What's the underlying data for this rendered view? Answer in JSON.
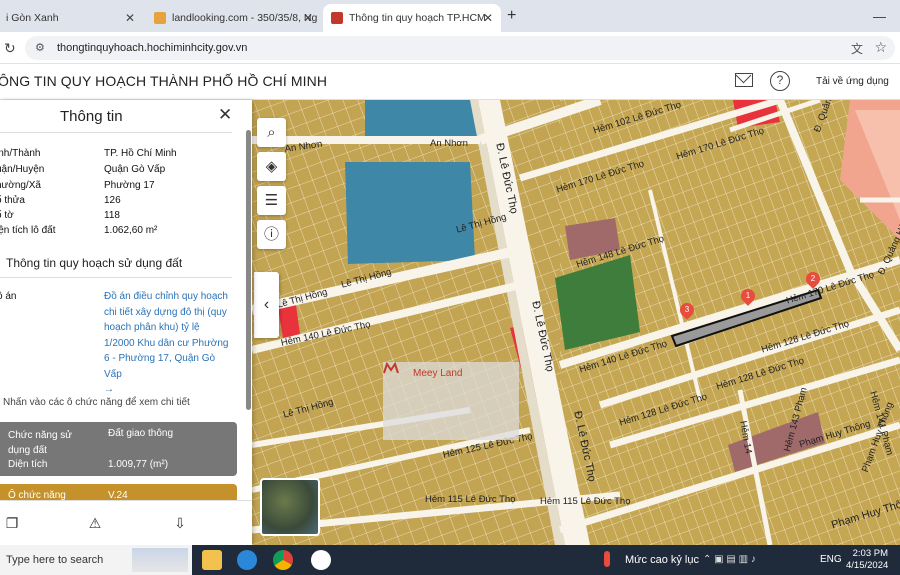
{
  "browser": {
    "tabs": [
      {
        "label": "i Gòn Xanh",
        "active": false
      },
      {
        "label": "landlooking.com - 350/35/8, Ng",
        "active": false
      },
      {
        "label": "Thông tin quy hoạch TP.HCM",
        "active": true
      }
    ],
    "url": "thongtinquyhoach.hochiminhcity.gov.vn"
  },
  "site": {
    "title": "ÔNG TIN QUY HOẠCH THÀNH PHỐ HỒ CHÍ MINH",
    "download_app": "Tải về ứng dụng"
  },
  "panel": {
    "title": "Thông tin",
    "fields": [
      {
        "key": "ỉnh/Thành",
        "value": "TP. Hồ Chí Minh"
      },
      {
        "key": "uận/Huyện",
        "value": "Quận Gò Vấp"
      },
      {
        "key": "hường/Xã",
        "value": "Phường 17"
      },
      {
        "key": "ố thửa",
        "value": "126"
      },
      {
        "key": "ố tờ",
        "value": "118"
      },
      {
        "key": "iện tích lô đất",
        "value": "1.062,60 m²"
      }
    ],
    "section_title": "Thông tin quy hoạch sử dụng đất",
    "plan_key": "ồ án",
    "plan_value": "Đồ án điều chỉnh quy hoạch chi tiết xây dựng đô thị (quy hoạch phân khu) tỷ lệ 1/2000 Khu dân cư Phường 6 - Phường 17, Quận Gò Vấp",
    "plan_arrow": "→",
    "hint": "Nhấn vào các ô chức năng để xem chi tiết",
    "function_label": "Chức năng sử dụng đất",
    "function_value": "Đất giao thông",
    "area_label": "Diện tích",
    "area_value": "1.009,77 (m²)",
    "cell_label": "Ô chức năng",
    "cell_value": "V.24"
  },
  "map": {
    "labels": {
      "an_nhon_1": "An Nhơn",
      "an_nhon_2": "An Nhơn",
      "le_thi_hong_1": "Lê Thị Hồng",
      "le_thi_hong_2": "Lê Thị Hồng",
      "le_thi_hong_3": "Lê Thị Hồng",
      "le_thi_hong_4": "Lê Thị Hồng",
      "d_le_duc_tho_1": "Đ. Lê Đức Thọ",
      "d_le_duc_tho_2": "Đ. Lê Đức Thọ",
      "d_le_duc_tho_3": "Đ. Lê Đức Thọ",
      "hem_102": "Hẻm 102 Lê Đức Thọ",
      "hem_170_1": "Hẻm 170 Lê Đức Thọ",
      "hem_170_2": "Hẻm 170 Lê Đức Thọ",
      "hem_170_3": "Hẻm 170 Lê Đức Thọ",
      "hem_148": "Hẻm 148 Lê Đức Thọ",
      "hem_140_1": "Hẻm 140 Lê Đức Thọ",
      "hem_140_2": "Hẻm 140 Lê Đức Thọ",
      "hem_128_1": "Hẻm 128 Lê Đức Thọ",
      "hem_128_2": "Hẻm 128 Lê Đức Thọ",
      "hem_128_3": "Hẻm 128 Lê Đức Thọ",
      "hem_125": "Hẻm 125 Lê Đức Thọ",
      "hem_115_1": "Hẻm 115 Lê Đức Thọ",
      "hem_115_2": "Hẻm 115 Lê Đức Thọ",
      "d_quang_ham_1": "Đ. Quảng Hàm",
      "d_quang_ham_2": "Đ. Quảng Hàm",
      "pham_huy_thong_1": "Phạm Huy Thông",
      "pham_huy_thong_2": "Phạm Huy Thông",
      "pham_huy_thong_3": "Phạm Huy Thông",
      "hem_14": "Hẻm 14",
      "hem_143": "Hẻm 143 Phạm",
      "hem_141": "Hẻm 141 Phạm"
    },
    "markers": [
      "1",
      "2",
      "3"
    ],
    "watermark": "Meey Land"
  },
  "taskbar": {
    "search": "Type here to search",
    "weather": "Mức cao kỷ lục",
    "lang": "ENG",
    "time": "2:03 PM",
    "date": "4/15/2024"
  }
}
